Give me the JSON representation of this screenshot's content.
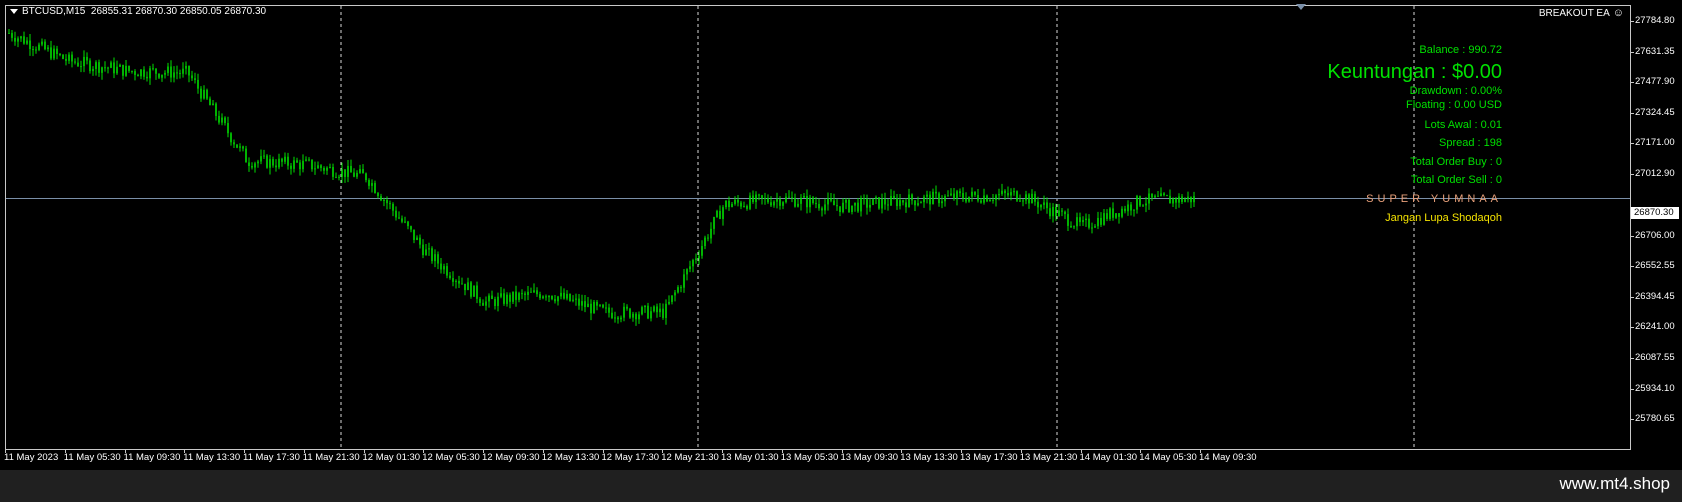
{
  "header": {
    "symbol": "BTCUSD,M15",
    "ohlc": "26855.31 26870.30 26850.05 26870.30",
    "ea_name": "BREAKOUT EA",
    "ea_icon": "smiley-icon"
  },
  "info_panel": {
    "balance": "Balance : 990.72",
    "profit": "Keuntungan : $0.00",
    "drawdown": "Drawdown  : 0.00%",
    "floating": "Floating : 0.00 USD",
    "lots": "Lots Awal : 0.01",
    "spread": "Spread : 198",
    "total_buy": "Total Order Buy  :  0",
    "total_sell": "Total Order Sell  :  0",
    "brand": "SUPER YUMNAA",
    "reminder": "Jangan Lupa Shodaqoh"
  },
  "price_axis": {
    "labels": [
      "27784.80",
      "27631.35",
      "27477.90",
      "27324.45",
      "27171.00",
      "27012.90",
      "26706.00",
      "26552.55",
      "26394.45",
      "26241.00",
      "26087.55",
      "25934.10",
      "25780.65"
    ],
    "current_price": "26870.30",
    "range": [
      25760,
      27810
    ]
  },
  "time_axis": {
    "labels": [
      "11 May 2023",
      "11 May 05:30",
      "11 May 09:30",
      "11 May 13:30",
      "11 May 17:30",
      "11 May 21:30",
      "12 May 01:30",
      "12 May 05:30",
      "12 May 09:30",
      "12 May 13:30",
      "12 May 17:30",
      "12 May 21:30",
      "13 May 01:30",
      "13 May 05:30",
      "13 May 09:30",
      "13 May 13:30",
      "13 May 17:30",
      "13 May 21:30",
      "14 May 01:30",
      "14 May 05:30",
      "14 May 09:30"
    ]
  },
  "chart_data": {
    "type": "line",
    "title": "BTCUSD,M15",
    "xlabel": "",
    "ylabel": "",
    "ylim": [
      25780.65,
      27784.8
    ],
    "x": [
      "11 May 2023",
      "11 May 05:30",
      "11 May 09:30",
      "11 May 13:30",
      "11 May 17:30",
      "11 May 21:30",
      "12 May 01:30",
      "12 May 05:30",
      "12 May 09:30",
      "12 May 13:30",
      "12 May 17:30",
      "12 May 21:30",
      "13 May 01:30",
      "13 May 05:30",
      "13 May 09:30",
      "13 May 13:30",
      "13 May 17:30",
      "13 May 21:30",
      "14 May 01:30",
      "14 May 05:30",
      "14 May 09:30"
    ],
    "series": [
      {
        "values": [
          27700,
          27560,
          27510,
          27500,
          27060,
          27040,
          26980,
          26600,
          26350,
          26400,
          26300,
          26300,
          26840,
          26870,
          26830,
          26860,
          26880,
          26890,
          26730,
          26860,
          26870
        ]
      }
    ],
    "current_price": 26870.3,
    "period_separators": [
      "11 May 21:30",
      "12 May 21:30",
      "13 May 21:30",
      "14 May 21:30"
    ],
    "colors": {
      "candle": "#00e000",
      "background": "#000000",
      "grid": "#ffffff",
      "bid_line": "#7a8fa8"
    }
  },
  "watermark": "www.mt4.shop"
}
